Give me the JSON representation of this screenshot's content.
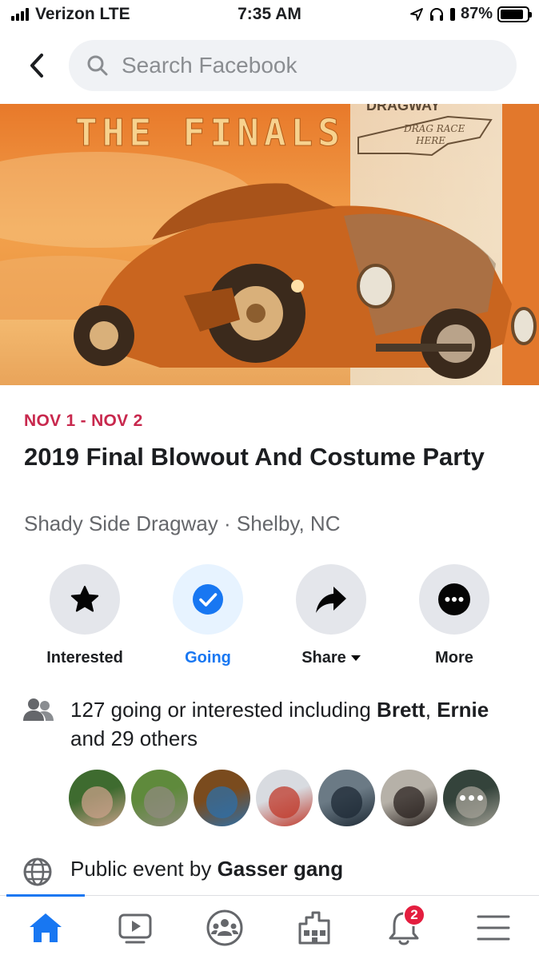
{
  "status_bar": {
    "carrier": "Verizon LTE",
    "time": "7:35 AM",
    "battery": "87%",
    "battery_level": 0.87,
    "icons": [
      "signal-bars-icon",
      "location-arrow-icon",
      "headphones-icon",
      "battery-icon"
    ]
  },
  "header": {
    "back_icon": "chevron-left-icon",
    "search_placeholder": "Search Facebook"
  },
  "cover": {
    "text_top": "THE FINALS",
    "stamp_top": "DRAGWAY",
    "stamp_line1": "DRAG RACE",
    "stamp_line2": "HERE"
  },
  "event": {
    "date": "NOV 1 - NOV 2",
    "title": "2019 Final Blowout And Costume Party",
    "location": "Shady Side Dragway · Shelby, NC"
  },
  "actions": [
    {
      "label": "Interested",
      "icon": "star-icon",
      "active": false
    },
    {
      "label": "Going",
      "icon": "check-circle-icon",
      "active": true
    },
    {
      "label": "Share",
      "icon": "share-arrow-icon",
      "active": false,
      "has_dropdown": true
    },
    {
      "label": "More",
      "icon": "more-dots-icon",
      "active": false
    }
  ],
  "attendance": {
    "prefix": "127 going or interested including ",
    "name1": "Brett",
    "sep": ",",
    "name2": "Ernie",
    "suffix": " and 29 others"
  },
  "avatars": [
    {
      "name": "attendee-1",
      "colors": [
        "#3e6b2f",
        "#c9a08a"
      ]
    },
    {
      "name": "attendee-2",
      "colors": [
        "#5f8a3c",
        "#8f8a7e"
      ]
    },
    {
      "name": "attendee-3",
      "colors": [
        "#7a4b1e",
        "#2e6fa8"
      ]
    },
    {
      "name": "attendee-4",
      "colors": [
        "#d8dbe0",
        "#c0392b"
      ]
    },
    {
      "name": "attendee-5",
      "colors": [
        "#6b7a85",
        "#1e2a35"
      ]
    },
    {
      "name": "attendee-6",
      "colors": [
        "#b6b1a8",
        "#2b2320"
      ]
    },
    {
      "name": "attendee-7",
      "colors": [
        "#465a4f",
        "#d9d6c8"
      ]
    }
  ],
  "host": {
    "prefix": "Public event by ",
    "name": "Gasser gang",
    "icon": "globe-icon"
  },
  "tabbar": {
    "tabs": [
      "home-icon",
      "watch-icon",
      "groups-icon",
      "marketplace-icon",
      "notifications-icon",
      "menu-icon"
    ],
    "notifications_badge": "2",
    "active_color": "#1877f2"
  }
}
